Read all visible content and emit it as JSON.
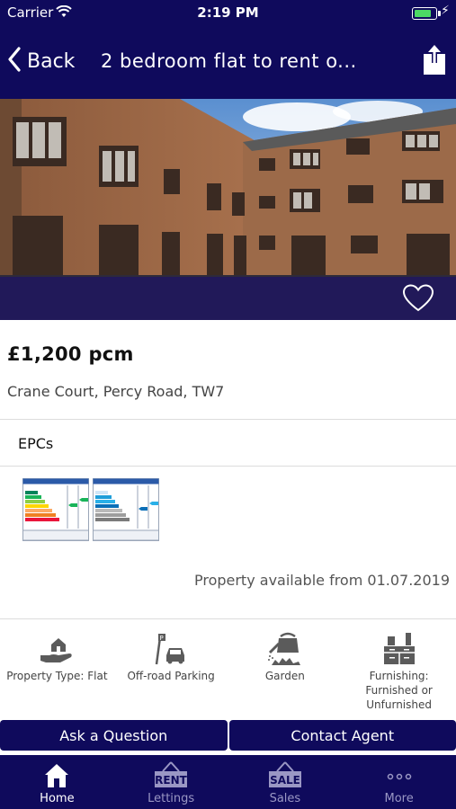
{
  "status_bar": {
    "carrier": "Carrier",
    "time": "2:19 PM",
    "battery_level": 0.8
  },
  "nav": {
    "back_label": "Back",
    "title": "2 bedroom flat to rent o..."
  },
  "listing": {
    "price": "£1,200 pcm",
    "address": "Crane Court, Percy Road, TW7",
    "epc_heading": "EPCs",
    "available": "Property available from 01.07.2019"
  },
  "features": [
    {
      "icon": "house-hand-icon",
      "label": "Property Type: Flat"
    },
    {
      "icon": "parking-icon",
      "label": "Off-road Parking"
    },
    {
      "icon": "watering-can-icon",
      "label": "Garden"
    },
    {
      "icon": "furniture-icon",
      "label": "Furnishing: Furnished or Unfurnished"
    }
  ],
  "actions": {
    "ask_label": "Ask a Question",
    "contact_label": "Contact Agent"
  },
  "tabs": [
    {
      "label": "Home",
      "icon": "home-icon",
      "active": true
    },
    {
      "label": "Lettings",
      "icon": "rent-sign-icon",
      "badge": "RENT"
    },
    {
      "label": "Sales",
      "icon": "sale-sign-icon",
      "badge": "SALE"
    },
    {
      "label": "More",
      "icon": "more-dots-icon"
    }
  ],
  "colors": {
    "brand": "#0f0a5c",
    "tab_inactive": "#9a97c4"
  }
}
